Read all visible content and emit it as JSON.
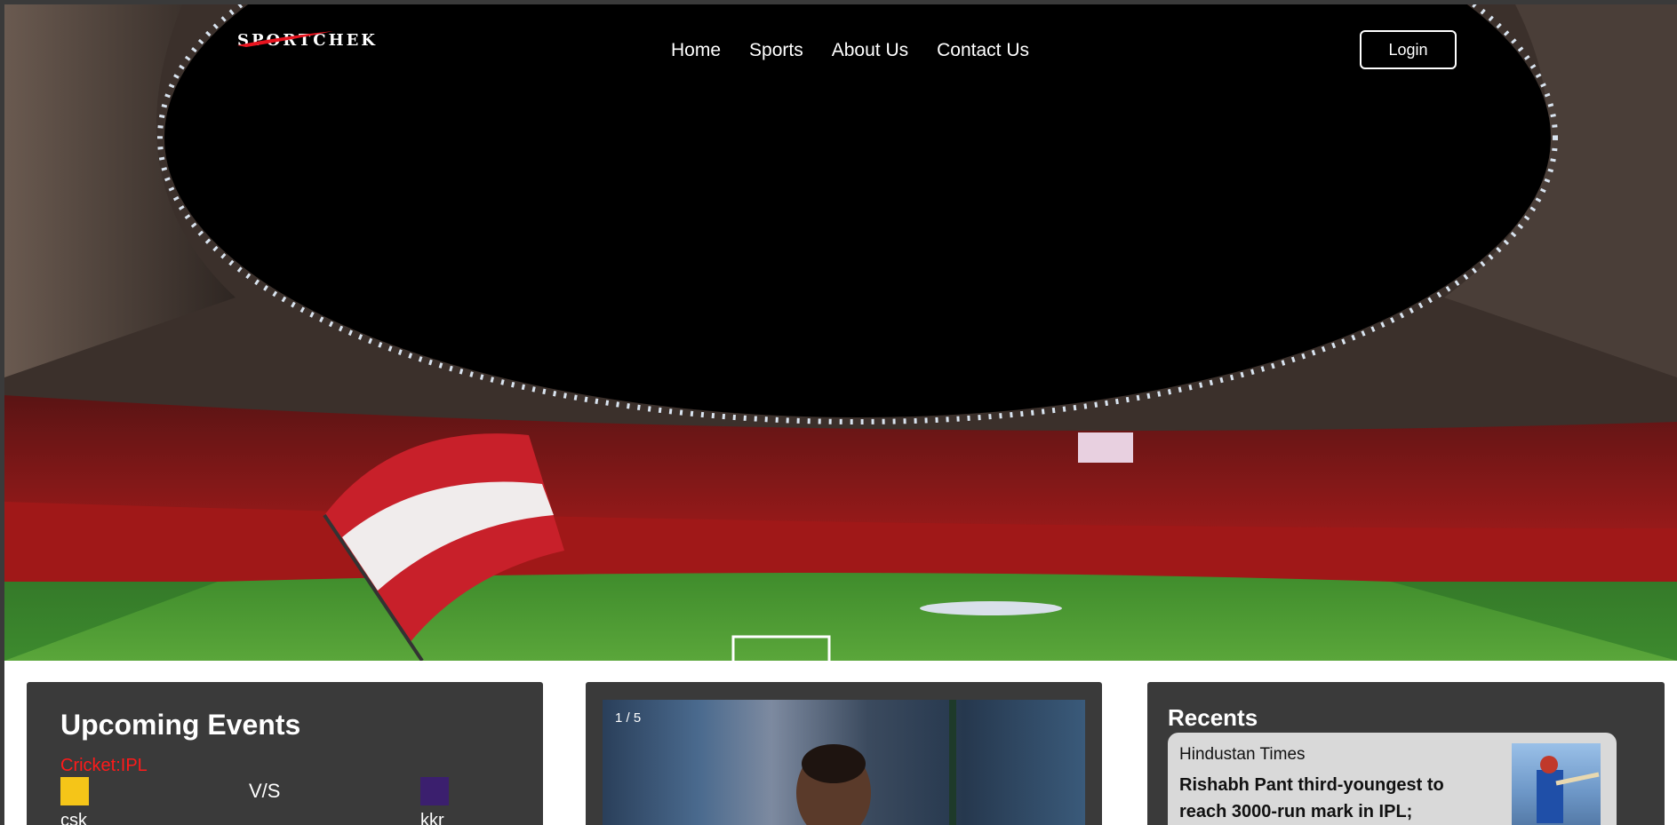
{
  "header": {
    "logo_text": "SPORTCHEK",
    "nav": [
      {
        "label": "Home"
      },
      {
        "label": "Sports"
      },
      {
        "label": "About Us"
      },
      {
        "label": "Contact Us"
      }
    ],
    "login_label": "Login"
  },
  "hero": {
    "image": "stadium-photo",
    "colors": {
      "sky": "#000000",
      "stands": "#8a1a1a",
      "pitch": "#3d8a2e"
    }
  },
  "events": {
    "title": "Upcoming Events",
    "category": "Cricket:IPL",
    "team_a": "csk",
    "vs": "V/S",
    "team_b": "kkr",
    "accent_color": "#ff1a1a"
  },
  "carousel": {
    "counter": "1 / 5"
  },
  "recents": {
    "title": "Recents",
    "items": [
      {
        "source": "Hindustan Times",
        "headline": "Rishabh Pant third-youngest to reach 3000-run mark in IPL;"
      }
    ]
  }
}
